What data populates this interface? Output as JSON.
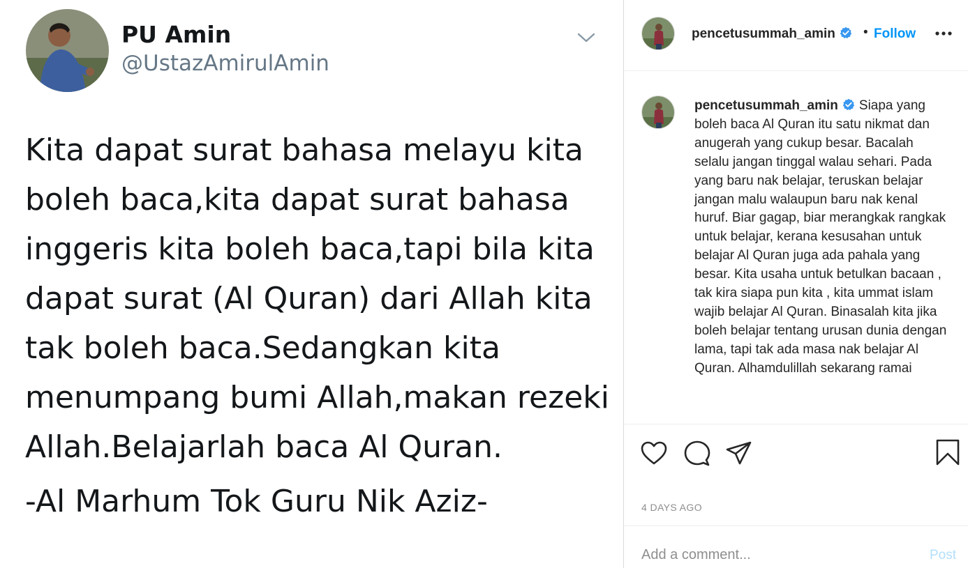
{
  "tweet": {
    "display_name": "PU Amin",
    "handle": "@UstazAmirulAmin",
    "lines": [
      "Kita dapat surat bahasa melayu kita",
      "boleh baca,kita dapat surat bahasa",
      "inggeris kita boleh baca,tapi bila kita",
      "dapat surat (Al Quran) dari Allah kita",
      "tak boleh baca.Sedangkan kita",
      "menumpang bumi Allah,makan rezeki",
      "Allah.Belajarlah baca Al Quran."
    ],
    "signature": "-Al Marhum Tok Guru Nik Aziz-"
  },
  "instagram": {
    "header": {
      "username": "pencetusummah_amin",
      "separator": "•",
      "follow_label": "Follow"
    },
    "caption": {
      "username": "pencetusummah_amin",
      "text": "Siapa yang boleh baca Al Quran itu satu nikmat dan anugerah yang cukup besar. Bacalah selalu jangan tinggal walau sehari. Pada yang baru nak belajar, teruskan belajar jangan malu walaupun baru nak kenal huruf. Biar gagap, biar merangkak rangkak untuk belajar, kerana kesusahan untuk belajar Al Quran juga ada pahala yang besar. Kita usaha untuk betulkan bacaan , tak kira siapa pun kita , kita ummat islam wajib belajar Al Quran. Binasalah kita jika boleh belajar tentang urusan dunia dengan lama, tapi tak ada masa nak belajar Al Quran. Alhamdulillah sekarang ramai"
    },
    "timestamp": "4 DAYS AGO",
    "comment": {
      "placeholder": "Add a comment...",
      "post_label": "Post"
    },
    "colors": {
      "accent": "#0095f6",
      "post_disabled": "#b2dffc",
      "verified": "#3897f0"
    }
  }
}
